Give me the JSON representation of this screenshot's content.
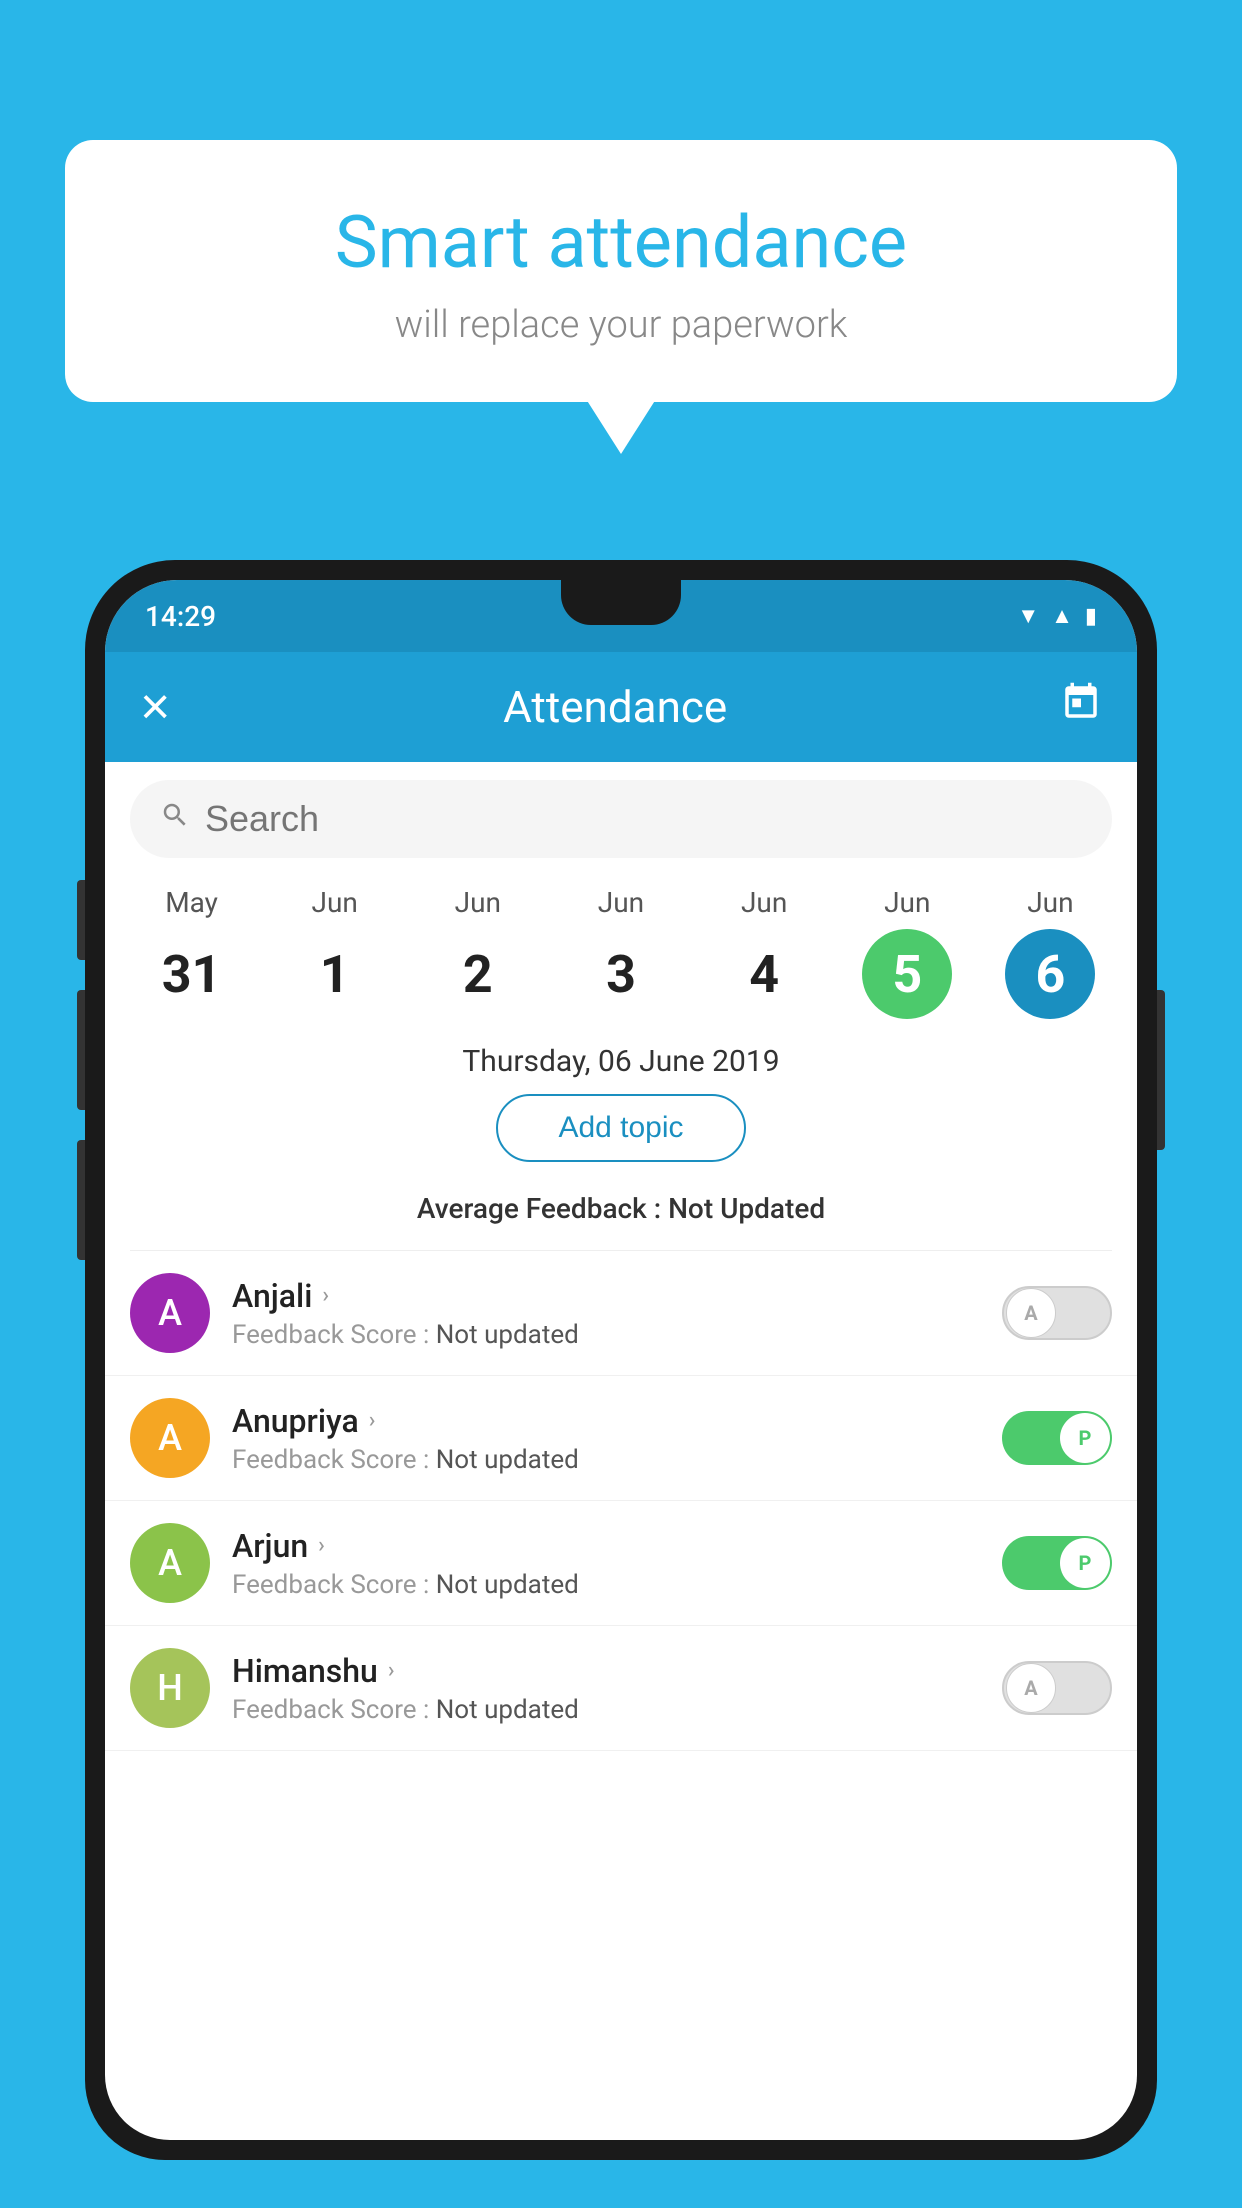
{
  "background_color": "#29b6e8",
  "speech_bubble": {
    "title": "Smart attendance",
    "subtitle": "will replace your paperwork"
  },
  "status_bar": {
    "time": "14:29",
    "icons": [
      "wifi",
      "signal",
      "battery"
    ]
  },
  "app_bar": {
    "title": "Attendance",
    "close_label": "×",
    "calendar_icon": "📅"
  },
  "search": {
    "placeholder": "Search"
  },
  "calendar": {
    "days": [
      {
        "month": "May",
        "date": "31",
        "style": "normal"
      },
      {
        "month": "Jun",
        "date": "1",
        "style": "normal"
      },
      {
        "month": "Jun",
        "date": "2",
        "style": "normal"
      },
      {
        "month": "Jun",
        "date": "3",
        "style": "normal"
      },
      {
        "month": "Jun",
        "date": "4",
        "style": "normal"
      },
      {
        "month": "Jun",
        "date": "5",
        "style": "green"
      },
      {
        "month": "Jun",
        "date": "6",
        "style": "blue"
      }
    ]
  },
  "selected_date": "Thursday, 06 June 2019",
  "add_topic_label": "Add topic",
  "average_feedback_label": "Average Feedback : ",
  "average_feedback_value": "Not Updated",
  "students": [
    {
      "name": "Anjali",
      "avatar_letter": "A",
      "avatar_color": "#9c27b0",
      "feedback_label": "Feedback Score : ",
      "feedback_value": "Not updated",
      "toggle_state": "off",
      "toggle_label": "A"
    },
    {
      "name": "Anupriya",
      "avatar_letter": "A",
      "avatar_color": "#f5a623",
      "feedback_label": "Feedback Score : ",
      "feedback_value": "Not updated",
      "toggle_state": "on",
      "toggle_label": "P"
    },
    {
      "name": "Arjun",
      "avatar_letter": "A",
      "avatar_color": "#8bc34a",
      "feedback_label": "Feedback Score : ",
      "feedback_value": "Not updated",
      "toggle_state": "on",
      "toggle_label": "P"
    },
    {
      "name": "Himanshu",
      "avatar_letter": "H",
      "avatar_color": "#a5c45a",
      "feedback_label": "Feedback Score : ",
      "feedback_value": "Not updated",
      "toggle_state": "off",
      "toggle_label": "A"
    }
  ]
}
